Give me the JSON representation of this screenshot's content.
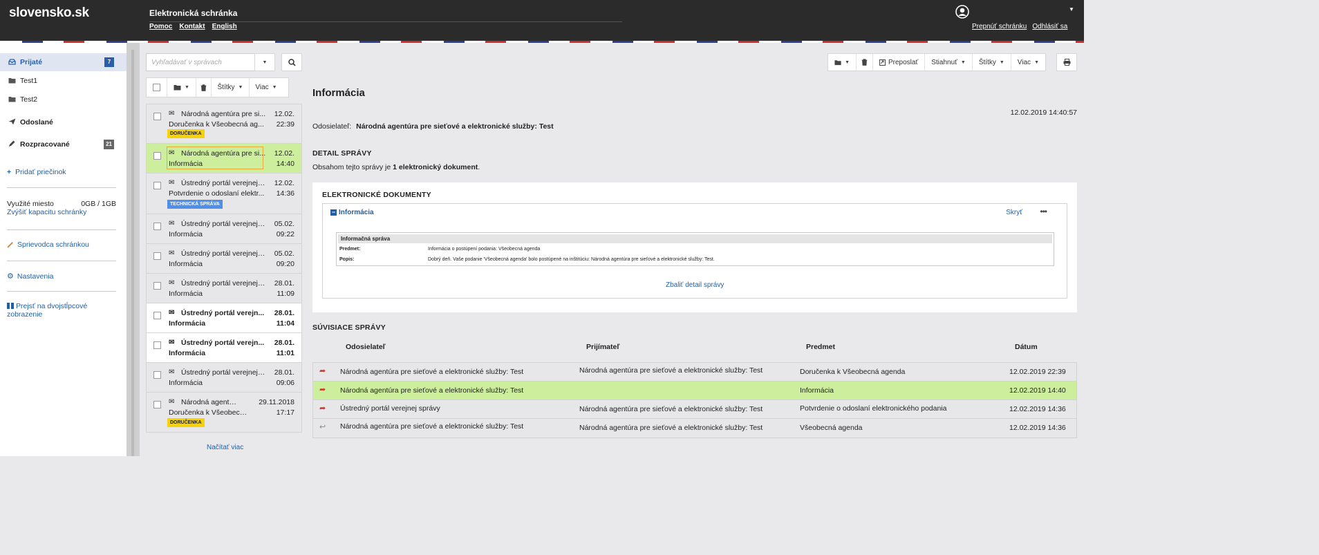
{
  "header": {
    "logo": "slovensko.sk",
    "app_title": "Elektronická schránka",
    "links": [
      "Pomoc",
      "Kontakt",
      "English"
    ],
    "switch_box": "Prepnúť schránku",
    "logout": "Odhlásiť sa"
  },
  "sidebar": {
    "items": [
      {
        "label": "Prijaté",
        "icon": "inbox-icon",
        "badge": "7"
      },
      {
        "label": "Test1",
        "icon": "folder-icon"
      },
      {
        "label": "Test2",
        "icon": "folder-icon"
      },
      {
        "label": "Odoslané",
        "icon": "send-icon"
      },
      {
        "label": "Rozpracované",
        "icon": "pencil-icon",
        "badge": "21"
      }
    ],
    "add_folder": "Pridať priečinok",
    "storage_label": "Využité miesto",
    "storage_value": "0GB / 1GB",
    "increase_capacity": "Zvýšiť kapacitu schránky",
    "guide": "Sprievodca schránkou",
    "settings": "Nastavenia",
    "two_column": "Prejsť na dvojstĺpcové zobrazenie"
  },
  "colors": {
    "badge_blue": "#2a5ea8",
    "badge_grey": "#666666",
    "selected_green": "#cdef9d",
    "tag_yellow": "#f5d20a",
    "tag_blue": "#4f8fe8",
    "arrow_red": "#d33a2c",
    "link_blue": "#1f5fa6"
  },
  "search": {
    "placeholder": "Vyhľadávať v správach"
  },
  "list_toolbar": {
    "labels": "Štítky",
    "more": "Viac"
  },
  "messages": [
    {
      "sender": "Národná agentúra pre si...",
      "subject": "Doručenka k Všeobecná ag...",
      "date": "12.02.",
      "time": "22:39",
      "tag": "DORUČENKA",
      "tag_color": "yellow",
      "state": "read"
    },
    {
      "sender": "Národná agentúra pre si...",
      "subject": "Informácia",
      "date": "12.02.",
      "time": "14:40",
      "state": "selected"
    },
    {
      "sender": "Ústredný portál verejnej ...",
      "subject": "Potvrdenie o odoslaní elektr...",
      "date": "12.02.",
      "time": "14:36",
      "tag": "TECHNICKÁ SPRÁVA",
      "tag_color": "blue",
      "state": "read"
    },
    {
      "sender": "Ústredný portál verejnej ...",
      "subject": "Informácia",
      "date": "05.02.",
      "time": "09:22",
      "state": "read"
    },
    {
      "sender": "Ústredný portál verejnej ...",
      "subject": "Informácia",
      "date": "05.02.",
      "time": "09:20",
      "state": "read"
    },
    {
      "sender": "Ústredný portál verejnej ...",
      "subject": "Informácia",
      "date": "28.01.",
      "time": "11:09",
      "state": "read"
    },
    {
      "sender": "Ústredný portál verejn...",
      "subject": "Informácia",
      "date": "28.01.",
      "time": "11:04",
      "state": "unread"
    },
    {
      "sender": "Ústredný portál verejn...",
      "subject": "Informácia",
      "date": "28.01.",
      "time": "11:01",
      "state": "unread"
    },
    {
      "sender": "Ústredný portál verejnej ...",
      "subject": "Informácia",
      "date": "28.01.",
      "time": "09:06",
      "state": "read"
    },
    {
      "sender": "Národná agentúra ...",
      "subject": "Doručenka k Všeobecn...",
      "date": "29.11.2018",
      "time": "17:17",
      "tag": "DORUČENKA",
      "tag_color": "yellow",
      "state": "read"
    }
  ],
  "load_more": "Načítať viac",
  "detail_toolbar": {
    "forward": "Preposlať",
    "download": "Stiahnuť",
    "labels": "Štítky",
    "more": "Viac"
  },
  "detail": {
    "title": "Informácia",
    "datetime": "12.02.2019 14:40:57",
    "sender_label": "Odosielateľ:",
    "sender": "Národná agentúra pre sieťové a elektronické služby: Test",
    "detail_heading": "DETAIL SPRÁVY",
    "contains_prefix": "Obsahom tejto správy je ",
    "contains_bold": "1 elektronický dokument",
    "contains_suffix": ".",
    "docs_heading": "ELEKTRONICKÉ DOKUMENTY",
    "doc_name": "Informácia",
    "hide": "Skryť",
    "info_title": "Informačná správa",
    "subject_label": "Predmet:",
    "subject_value": "Informácia o postúpení podania: Všeobecná agenda",
    "desc_label": "Popis:",
    "desc_value": "Dobrý deň. Vaše podanie 'Všeobecná agenda' bolo postúpené na inštitúciu: Národná agentúra pre sieťové a elektronické služby: Test.",
    "collapse": "Zbaliť detail správy"
  },
  "related": {
    "heading": "SÚVISIACE SPRÁVY",
    "columns": [
      "Odosielateľ",
      "Prijímateľ",
      "Predmet",
      "Dátum"
    ],
    "rows": [
      {
        "sender": "Národná agentúra pre sieťové a elektronické služby: Test",
        "recipient": "Národná agentúra pre sieťové a elektronické služby: Test",
        "subject": "Doručenka k Všeobecná agenda",
        "date": "12.02.2019 22:39",
        "dir": "forward"
      },
      {
        "sender": "Národná agentúra pre sieťové a elektronické služby: Test",
        "recipient": "",
        "subject": "Informácia",
        "date": "12.02.2019 14:40",
        "dir": "forward",
        "highlight": true
      },
      {
        "sender": "Ústredný portál verejnej správy",
        "recipient": "Národná agentúra pre sieťové a elektronické služby: Test",
        "subject": "Potvrdenie o odoslaní elektronického podania",
        "date": "12.02.2019 14:36",
        "dir": "forward"
      },
      {
        "sender": "Národná agentúra pre sieťové a elektronické služby: Test",
        "recipient": "Národná agentúra pre sieťové a elektronické služby: Test",
        "subject": "Všeobecná agenda",
        "date": "12.02.2019 14:36",
        "dir": "reply"
      }
    ]
  }
}
